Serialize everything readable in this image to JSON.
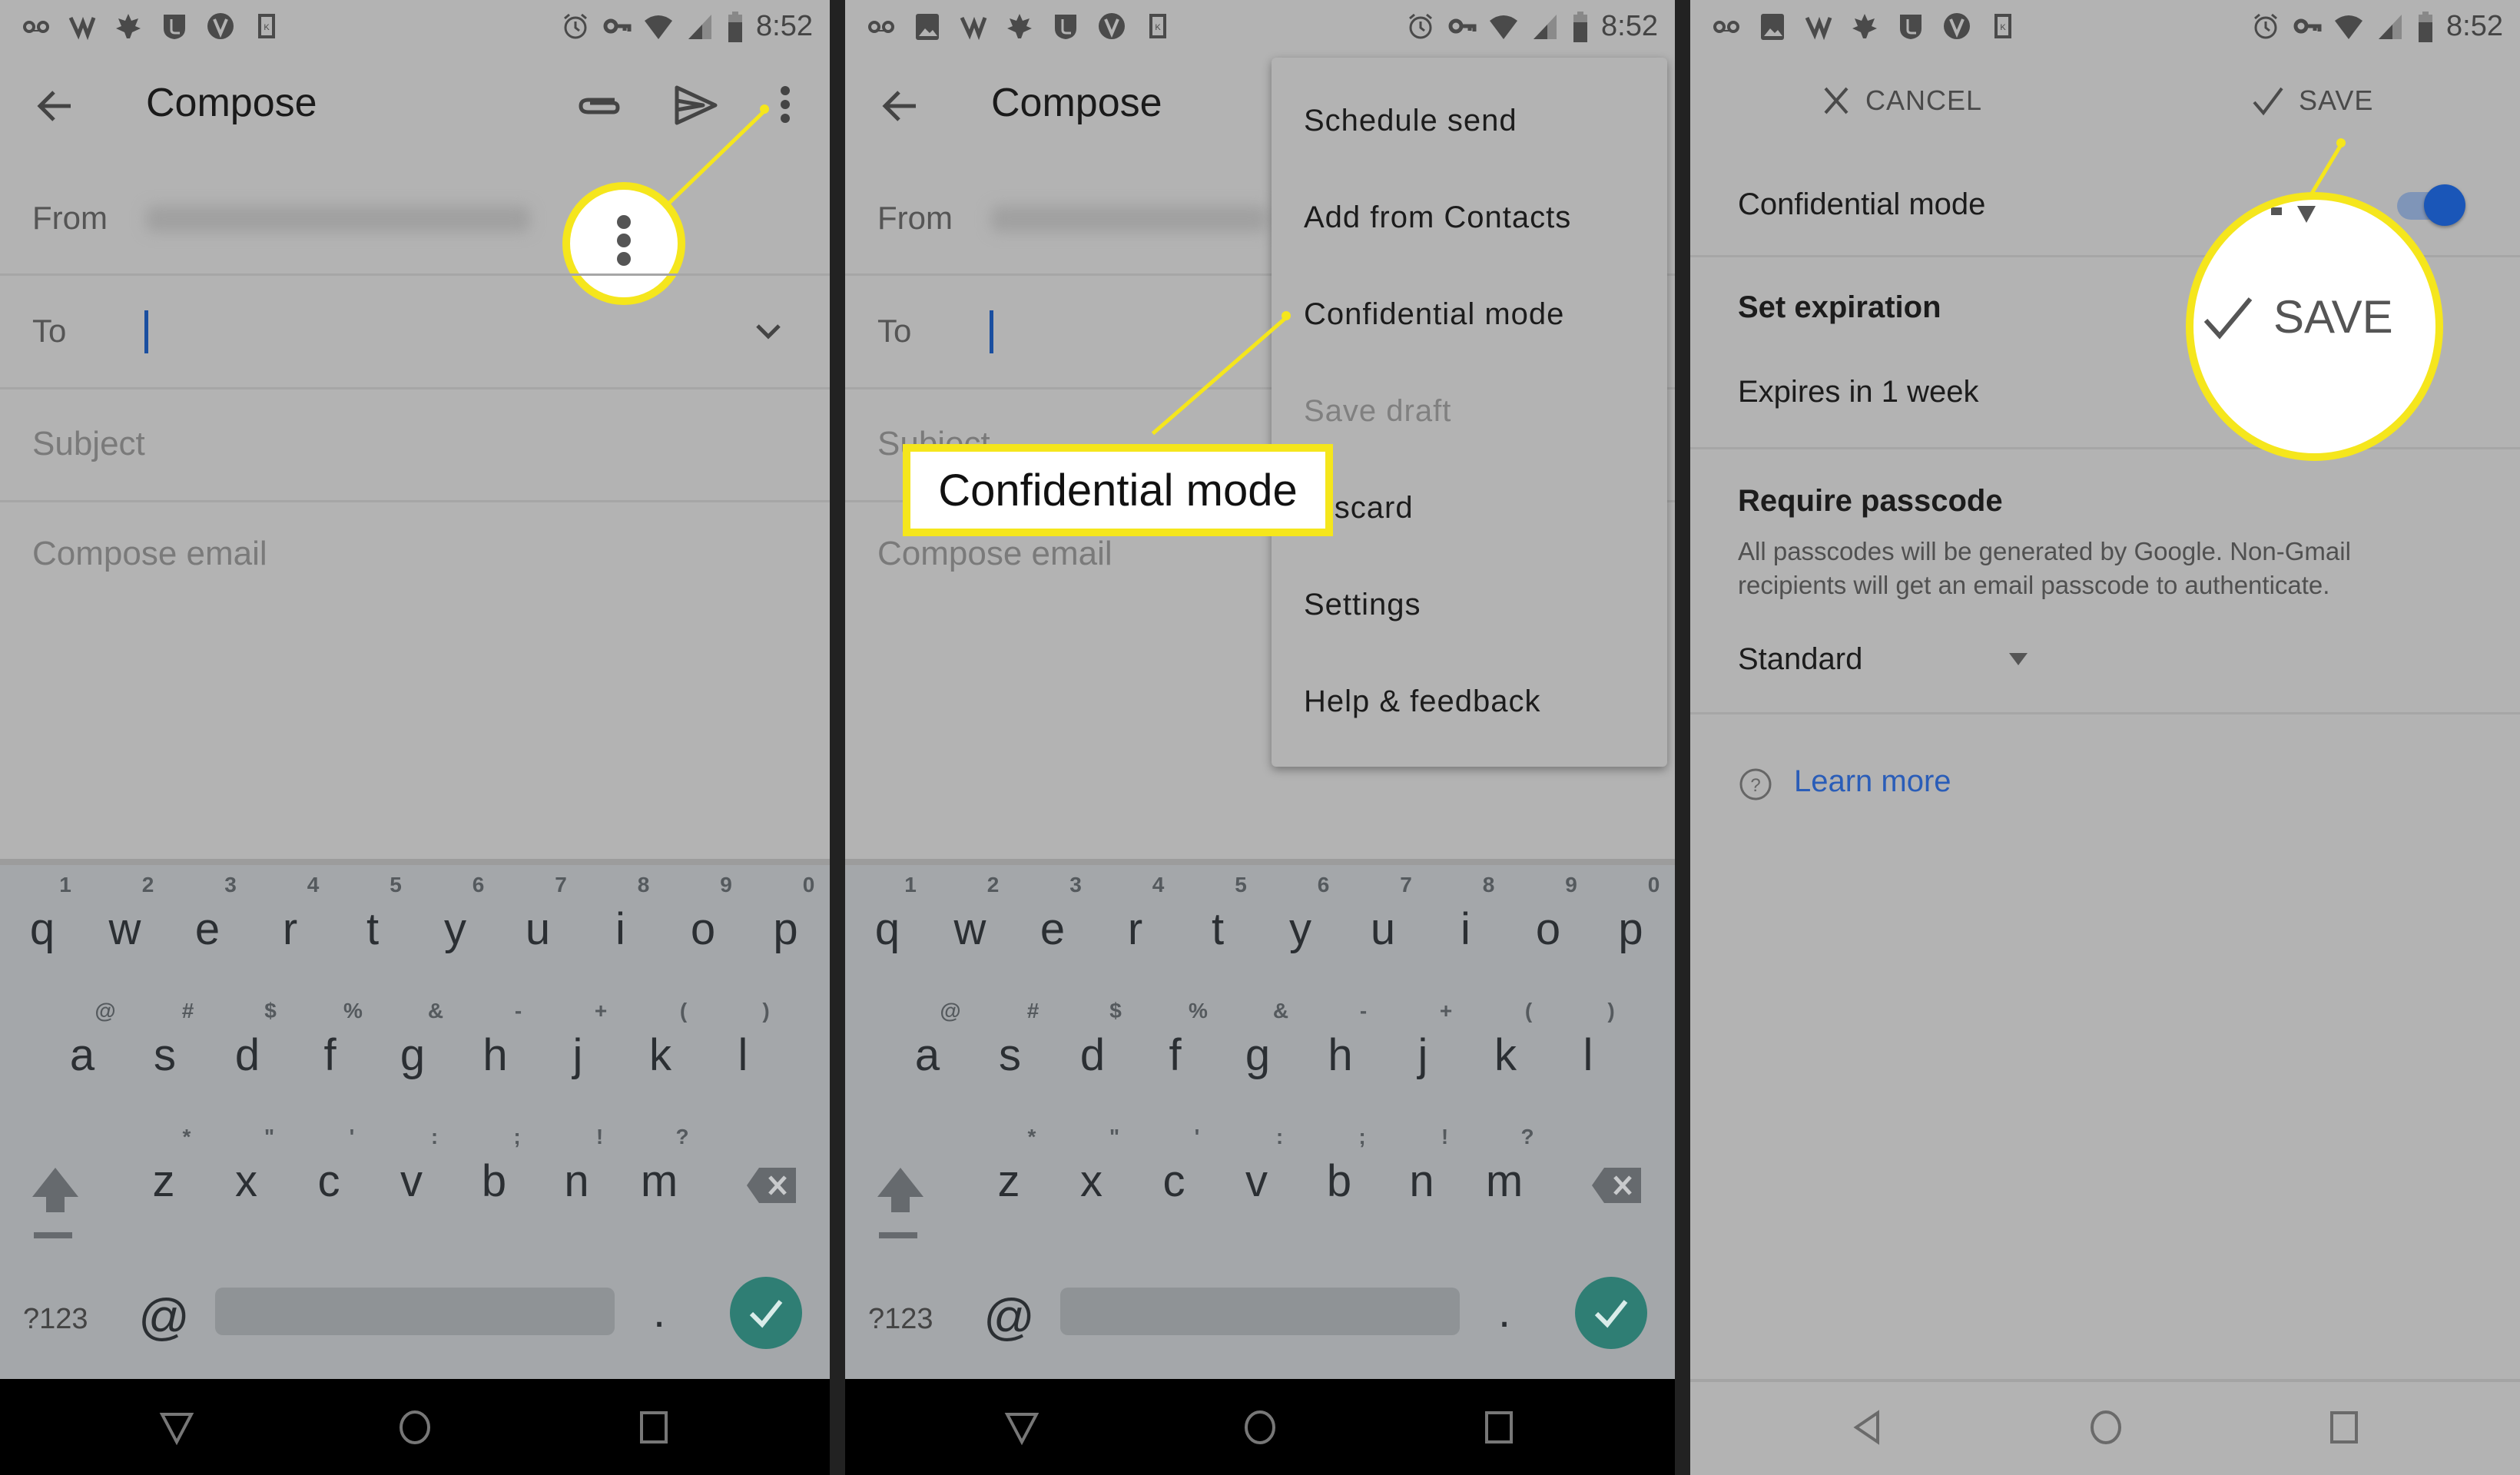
{
  "status_bar": {
    "time": "8:52",
    "left_icons_p1": [
      "voicemail-icon",
      "vf-app-icon",
      "maple-leaf-icon",
      "shield-app-icon",
      "v-app-icon",
      "k-app-icon"
    ],
    "left_icons_p23": [
      "voicemail-icon",
      "image-icon",
      "vf-app-icon",
      "maple-leaf-icon",
      "shield-app-icon",
      "v-app-icon",
      "k-app-icon"
    ],
    "right_icons": [
      "alarm-icon",
      "vpn-key-icon",
      "wifi-icon",
      "cell-signal-icon",
      "battery-icon"
    ]
  },
  "compose": {
    "title": "Compose",
    "from_label": "From",
    "to_label": "To",
    "subject_placeholder": "Subject",
    "body_placeholder": "Compose email"
  },
  "overflow_menu": {
    "items": [
      {
        "label": "Schedule send",
        "disabled": false
      },
      {
        "label": "Add from Contacts",
        "disabled": false
      },
      {
        "label": "Confidential mode",
        "disabled": false
      },
      {
        "label": "Save draft",
        "disabled": true
      },
      {
        "label": "Discard",
        "disabled": false
      },
      {
        "label": "Settings",
        "disabled": false
      },
      {
        "label": "Help & feedback",
        "disabled": false
      }
    ]
  },
  "callouts": {
    "menu_callout_label": "Confidential mode",
    "save_magnified_label": "SAVE"
  },
  "keyboard": {
    "row1": [
      "q",
      "w",
      "e",
      "r",
      "t",
      "y",
      "u",
      "i",
      "o",
      "p"
    ],
    "row1_hints": [
      "1",
      "2",
      "3",
      "4",
      "5",
      "6",
      "7",
      "8",
      "9",
      "0"
    ],
    "row2": [
      "a",
      "s",
      "d",
      "f",
      "g",
      "h",
      "j",
      "k",
      "l"
    ],
    "row2_hints": [
      "@",
      "#",
      "$",
      "%",
      "&",
      "-",
      "+",
      "(",
      ")"
    ],
    "row3": [
      "z",
      "x",
      "c",
      "v",
      "b",
      "n",
      "m"
    ],
    "row3_hints": [
      "*",
      "\"",
      "'",
      ":",
      ";",
      "!",
      "?"
    ],
    "symbols_key": "?123",
    "at_key": "@",
    "period_key": ".",
    "enter_color": "#2f7e74"
  },
  "confidential_settings": {
    "cancel_label": "CANCEL",
    "save_label": "SAVE",
    "toggle_label": "Confidential mode",
    "toggle_on": true,
    "set_expiration_heading": "Set expiration",
    "expiration_value": "Expires in 1 week",
    "require_passcode_heading": "Require passcode",
    "passcode_description": "All passcodes will be generated by Google. Non-Gmail recipients will get an email passcode to authenticate.",
    "passcode_option": "Standard",
    "learn_more_label": "Learn more"
  },
  "colors": {
    "highlight": "#f5e61c",
    "accent_blue": "#1a56b8",
    "link_blue": "#2a5db8"
  }
}
